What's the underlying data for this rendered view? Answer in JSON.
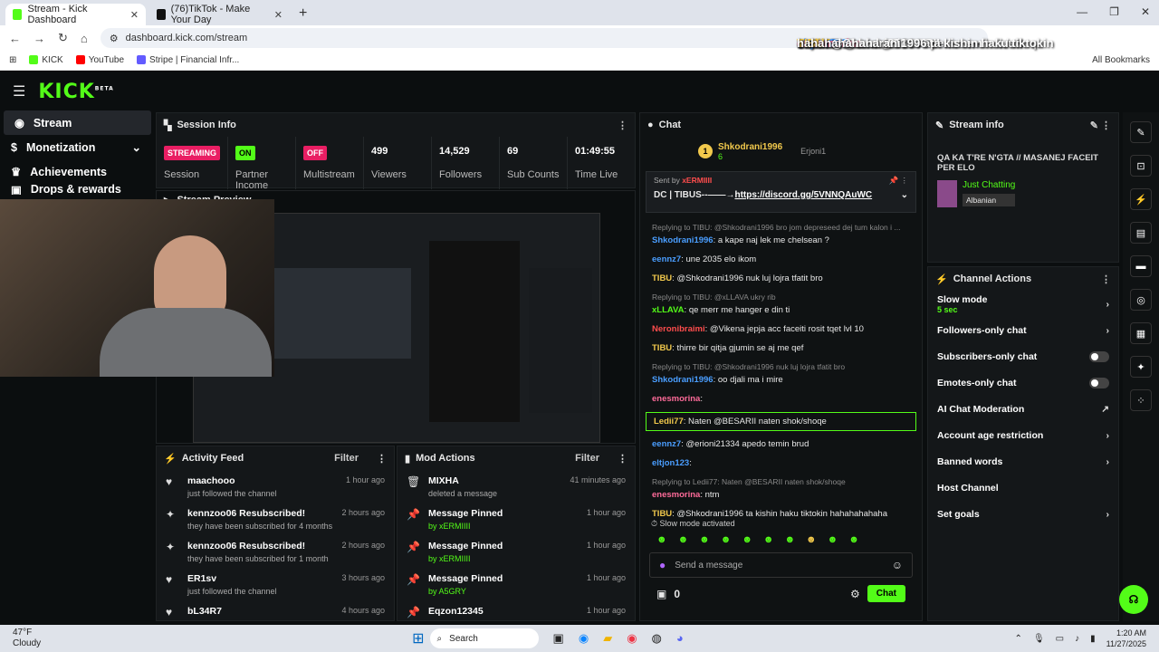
{
  "browser": {
    "tabs": [
      {
        "title": "Stream - Kick Dashboard"
      },
      {
        "title": "(76)TikTok - Make Your Day"
      }
    ],
    "url": "dashboard.kick.com/stream",
    "bookmarks": [
      "KICK",
      "YouTube",
      "Stripe | Financial Infr..."
    ],
    "all_bookmarks": "All Bookmarks"
  },
  "sidebar": {
    "items": [
      "Stream",
      "Monetization",
      "Achievements",
      "Drops & rewards"
    ]
  },
  "session": {
    "title": "Session Info",
    "stats": [
      {
        "value": "STREAMING",
        "label": "Session"
      },
      {
        "value": "ON",
        "label": "Partner Income"
      },
      {
        "value": "OFF",
        "label": "Multistream"
      },
      {
        "value": "499",
        "label": "Viewers"
      },
      {
        "value": "14,529",
        "label": "Followers"
      },
      {
        "value": "69",
        "label": "Sub Counts"
      },
      {
        "value": "01:49:55",
        "label": "Time Live"
      }
    ]
  },
  "preview": {
    "title": "Stream Preview"
  },
  "activity": {
    "title": "Activity Feed",
    "filter": "Filter",
    "items": [
      {
        "name": "maachooo",
        "sub": "just followed the channel",
        "time": "1 hour ago",
        "icon": "heart"
      },
      {
        "name": "kennzoo06 Resubscribed!",
        "sub": "they have been subscribed for 4 months",
        "time": "2 hours ago",
        "icon": "sparkle"
      },
      {
        "name": "kennzoo06 Resubscribed!",
        "sub": "they have been subscribed for 1 month",
        "time": "2 hours ago",
        "icon": "sparkle"
      },
      {
        "name": "ER1sv",
        "sub": "just followed the channel",
        "time": "3 hours ago",
        "icon": "heart"
      },
      {
        "name": "bL34R7",
        "sub": "",
        "time": "4 hours ago",
        "icon": "heart"
      }
    ]
  },
  "mod": {
    "title": "Mod Actions",
    "filter": "Filter",
    "items": [
      {
        "name": "MIXHA",
        "sub": "deleted a message",
        "time": "41 minutes ago"
      },
      {
        "name": "Message Pinned",
        "sub": "by xERMIIII",
        "time": "1 hour ago"
      },
      {
        "name": "Message Pinned",
        "sub": "by xERMIIII",
        "time": "1 hour ago"
      },
      {
        "name": "Message Pinned",
        "sub": "by A5GRY",
        "time": "1 hour ago"
      },
      {
        "name": "Eqzon12345",
        "sub": "",
        "time": "1 hour ago"
      }
    ]
  },
  "chat": {
    "title": "Chat",
    "top_user": "Shkodrani1996",
    "top_count": "6",
    "top_user2": "Erjoni1",
    "pinned_by": "Sent by",
    "pinned_user": "xERMIIII",
    "pinned_text": "DC | TIBUS--——→",
    "pinned_link": "https://discord.gg/5VNNQAuWC",
    "messages": [
      {
        "reply": "Replying to TIBU: @Shkodrani1996 bro jom depreseed dej tum kalon i ..."
      },
      {
        "user": "Shkodrani1996",
        "color": "#4a9eff",
        "text": ": a kape naj lek me chelsean ?"
      },
      {
        "user": "eennz7",
        "color": "#4a9eff",
        "text": ": une 2035 elo ikom"
      },
      {
        "user": "TIBU",
        "color": "#f2c94c",
        "text": ": @Shkodrani1996 nuk luj lojra tfatit bro"
      },
      {
        "reply": "Replying to TIBU: @xLLAVA ukry rib"
      },
      {
        "user": "xLLAVA",
        "color": "#53fc18",
        "text": ": qe merr me hanger e din ti"
      },
      {
        "user": "Neronibraimi",
        "color": "#ff4d4d",
        "text": ": @Vikena jepja acc faceiti rosit tqet lvl 10"
      },
      {
        "user": "TIBU",
        "color": "#f2c94c",
        "text": ": thirre bir qitja gjumin se aj me qef"
      },
      {
        "reply": "Replying to TIBU: @Shkodrani1996 nuk luj lojra tfatit bro"
      },
      {
        "user": "Shkodrani1996",
        "color": "#4a9eff",
        "text": ": oo djali ma i mire"
      },
      {
        "user": "enesmorina",
        "color": "#ff6b9a",
        "text": ":"
      },
      {
        "user": "Ledii77",
        "color": "#f2c94c",
        "text": ": Naten @BESARII naten shok/shoqe"
      },
      {
        "user": "eennz7",
        "color": "#4a9eff",
        "text": ": @erioni21334 apedo temin brud"
      },
      {
        "user": "eltjon123",
        "color": "#4a9eff",
        "text": ":"
      },
      {
        "reply": "Replying to Ledii77: Naten @BESARII naten shok/shoqe"
      },
      {
        "user": "enesmorina",
        "color": "#ff6b9a",
        "text": ": ntm"
      },
      {
        "user": "TIBU",
        "color": "#f2c94c",
        "text": ": @Shkodrani1996 ta kishin haku tiktokin hahahahahaha"
      }
    ],
    "slow_mode": "Slow mode activated",
    "placeholder": "Send a message",
    "count": "0",
    "send": "Chat"
  },
  "stream_info": {
    "title": "Stream info",
    "description": "QA KA T'RE N'GTA // MASANEJ FACEIT PER ELO",
    "category": "Just Chatting",
    "tag": "Albanian"
  },
  "channel_actions": {
    "title": "Channel Actions",
    "items": [
      {
        "label": "Slow mode",
        "sub": "5 sec",
        "ctrl": "chev"
      },
      {
        "label": "Followers-only chat",
        "ctrl": "chev"
      },
      {
        "label": "Subscribers-only chat",
        "ctrl": "toggle"
      },
      {
        "label": "Emotes-only chat",
        "ctrl": "toggle"
      },
      {
        "label": "AI Chat Moderation",
        "ctrl": "ext"
      },
      {
        "label": "Account age restriction",
        "ctrl": "chev"
      },
      {
        "label": "Banned words",
        "ctrl": "chev"
      },
      {
        "label": "Host Channel",
        "ctrl": "none"
      },
      {
        "label": "Set goals",
        "ctrl": "chev"
      }
    ]
  },
  "overlay": [
    {
      "user": "Ledii77",
      "text": ": Naten @BESARII naten shok/shoqe",
      "color": "#f2c94c"
    },
    {
      "user": "eennz7",
      "text": ": @erioni21334 apedo temin brud",
      "color": "#4a9eff"
    },
    {
      "user": "eltjon123",
      "text": ":",
      "color": "#4a9eff"
    },
    {
      "user": "enesmorina",
      "text": ": ntm",
      "color": "#ff6b9a"
    },
    {
      "user": "TIBU",
      "text": ": @Shkodrani1996 ta kishin haku tiktokin",
      "color": "#f2c94c"
    },
    {
      "user": "",
      "text": "hahahahahaha",
      "color": "#fff"
    }
  ],
  "taskbar": {
    "temp": "47°F",
    "weather": "Cloudy",
    "search": "Search",
    "time": "1:20 AM",
    "date": "11/27/2025"
  }
}
